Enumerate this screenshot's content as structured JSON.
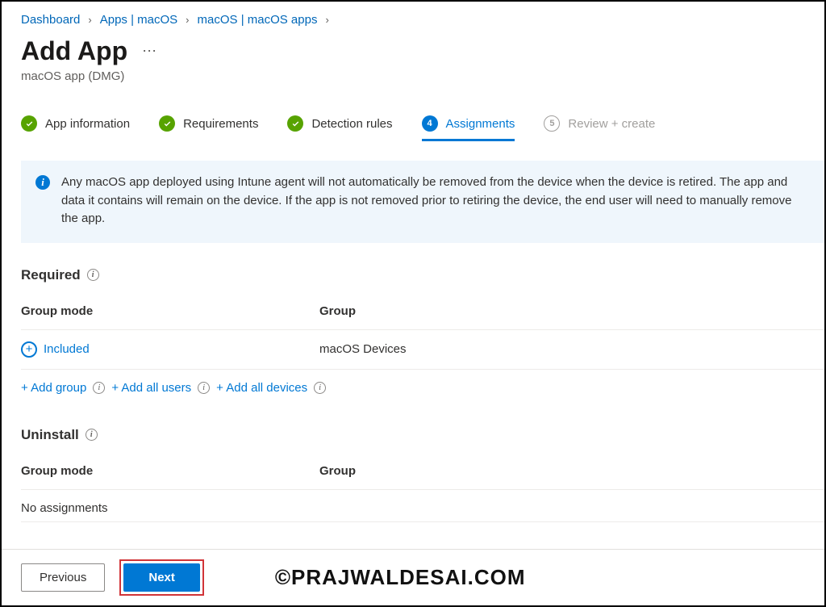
{
  "breadcrumb": {
    "items": [
      {
        "label": "Dashboard"
      },
      {
        "label": "Apps | macOS"
      },
      {
        "label": "macOS | macOS apps"
      }
    ]
  },
  "header": {
    "title": "Add App",
    "subtitle": "macOS app (DMG)"
  },
  "wizard": {
    "steps": [
      {
        "label": "App information",
        "state": "done"
      },
      {
        "label": "Requirements",
        "state": "done"
      },
      {
        "label": "Detection rules",
        "state": "done"
      },
      {
        "label": "Assignments",
        "state": "current",
        "number": "4"
      },
      {
        "label": "Review + create",
        "state": "pending",
        "number": "5"
      }
    ]
  },
  "info_bar": {
    "text": "Any macOS app deployed using Intune agent will not automatically be removed from the device when the device is retired. The app and data it contains will remain on the device. If the app is not removed prior to retiring the device, the end user will need to manually remove the app."
  },
  "required": {
    "title": "Required",
    "columns": {
      "mode": "Group mode",
      "group": "Group"
    },
    "rows": [
      {
        "mode": "Included",
        "group": "macOS Devices"
      }
    ],
    "actions": {
      "add_group": "+ Add group",
      "add_all_users": "+ Add all users",
      "add_all_devices": "+ Add all devices"
    }
  },
  "uninstall": {
    "title": "Uninstall",
    "columns": {
      "mode": "Group mode",
      "group": "Group"
    },
    "empty": "No assignments"
  },
  "footer": {
    "previous": "Previous",
    "next": "Next"
  },
  "watermark": "©PRAJWALDESAI.COM"
}
